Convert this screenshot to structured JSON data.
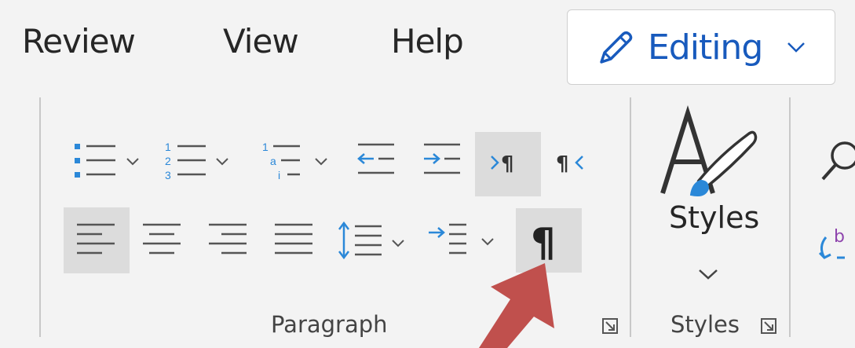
{
  "tabs": {
    "review": "Review",
    "view": "View",
    "help": "Help"
  },
  "editing": {
    "label": "Editing"
  },
  "groups": {
    "paragraph_label": "Paragraph",
    "styles_button_label": "Styles",
    "styles_group_label": "Styles"
  },
  "icons": {
    "bullets": "bulleted-list-icon",
    "numbering": "numbered-list-icon",
    "multilevel": "multilevel-list-icon",
    "decrease_indent": "decrease-indent-icon",
    "increase_indent": "increase-indent-icon",
    "ltr": "left-to-right-text-icon",
    "rtl": "right-to-left-text-icon",
    "align_left": "align-left-icon",
    "center": "align-center-icon",
    "align_right": "align-right-icon",
    "justify": "justify-icon",
    "line_spacing": "line-spacing-icon",
    "paragraph_indent": "paragraph-indent-icon",
    "show_marks": "pilcrow-icon",
    "styles": "styles-brush-icon",
    "find": "search-icon",
    "arrow": "red-arrow-pointer"
  },
  "colors": {
    "accent_blue": "#185abd",
    "icon_blue": "#2b88d8",
    "selected_bg": "#dcdcdc",
    "arrow_red": "#c0504d"
  }
}
